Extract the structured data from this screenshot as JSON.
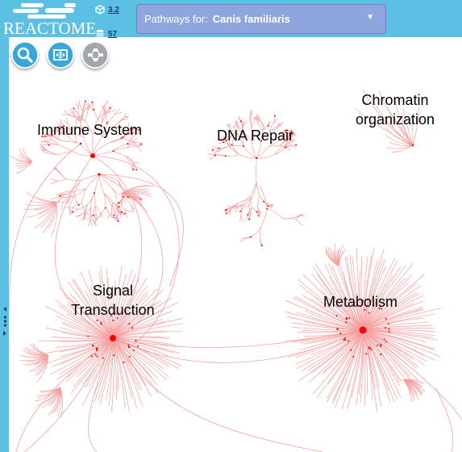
{
  "header": {
    "logo_text": "REACTOME",
    "version": "3.2",
    "pathway_count": "57"
  },
  "species": {
    "label": "Pathways for:",
    "selected": "Canis familiaris"
  },
  "toolbar": {
    "search": "search-icon",
    "fit": "fit-screen-icon",
    "layout": "hierarchy-icon"
  },
  "pathways": {
    "immune_system": "Immune System",
    "dna_repair": "DNA Repair",
    "chromatin_line1": "Chromatin",
    "chromatin_line2": "organization",
    "signal_line1": "Signal",
    "signal_line2": "Transduction",
    "metabolism": "Metabolism"
  },
  "colors": {
    "header_bg": "#5bc0e4",
    "selector_bg": "#8fa5dd",
    "edge": "#f4a0a0",
    "node": "#ff0000"
  }
}
